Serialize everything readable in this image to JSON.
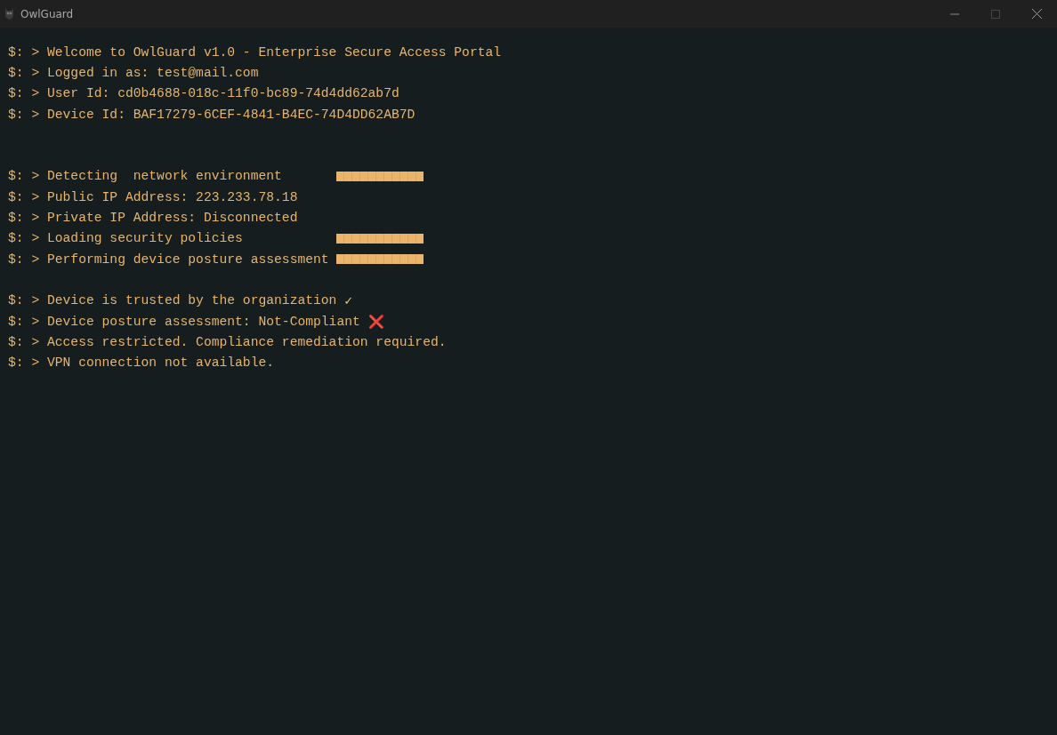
{
  "window": {
    "title": "OwlGuard"
  },
  "lines": [
    {
      "kind": "text",
      "text": "$: > Welcome to OwlGuard v1.0 - Enterprise Secure Access Portal"
    },
    {
      "kind": "text",
      "text": "$: > Logged in as: test@mail.com"
    },
    {
      "kind": "text",
      "text": "$: > User Id: cd0b4688-018c-11f0-bc89-74d4dd62ab7d"
    },
    {
      "kind": "text",
      "text": "$: > Device Id: BAF17279-6CEF-4841-B4EC-74D4DD62AB7D"
    },
    {
      "kind": "blank"
    },
    {
      "kind": "blank"
    },
    {
      "kind": "progress",
      "text": "$: > Detecting  network environment",
      "level": 1
    },
    {
      "kind": "text",
      "text": "$: > Public IP Address: 223.233.78.18"
    },
    {
      "kind": "text",
      "text": "$: > Private IP Address: Disconnected"
    },
    {
      "kind": "progress",
      "text": "$: > Loading security policies",
      "level": 1
    },
    {
      "kind": "progress",
      "text": "$: > Performing device posture assessment",
      "level": 1
    },
    {
      "kind": "blank"
    },
    {
      "kind": "check",
      "text": "$: > Device is trusted by the organization",
      "mark": "✓"
    },
    {
      "kind": "cross",
      "text": "$: > Device posture assessment: Not-Compliant",
      "mark": "❌"
    },
    {
      "kind": "text",
      "text": "$: > Access restricted. Compliance remediation required."
    },
    {
      "kind": "text",
      "text": "$: > VPN connection not available."
    }
  ]
}
